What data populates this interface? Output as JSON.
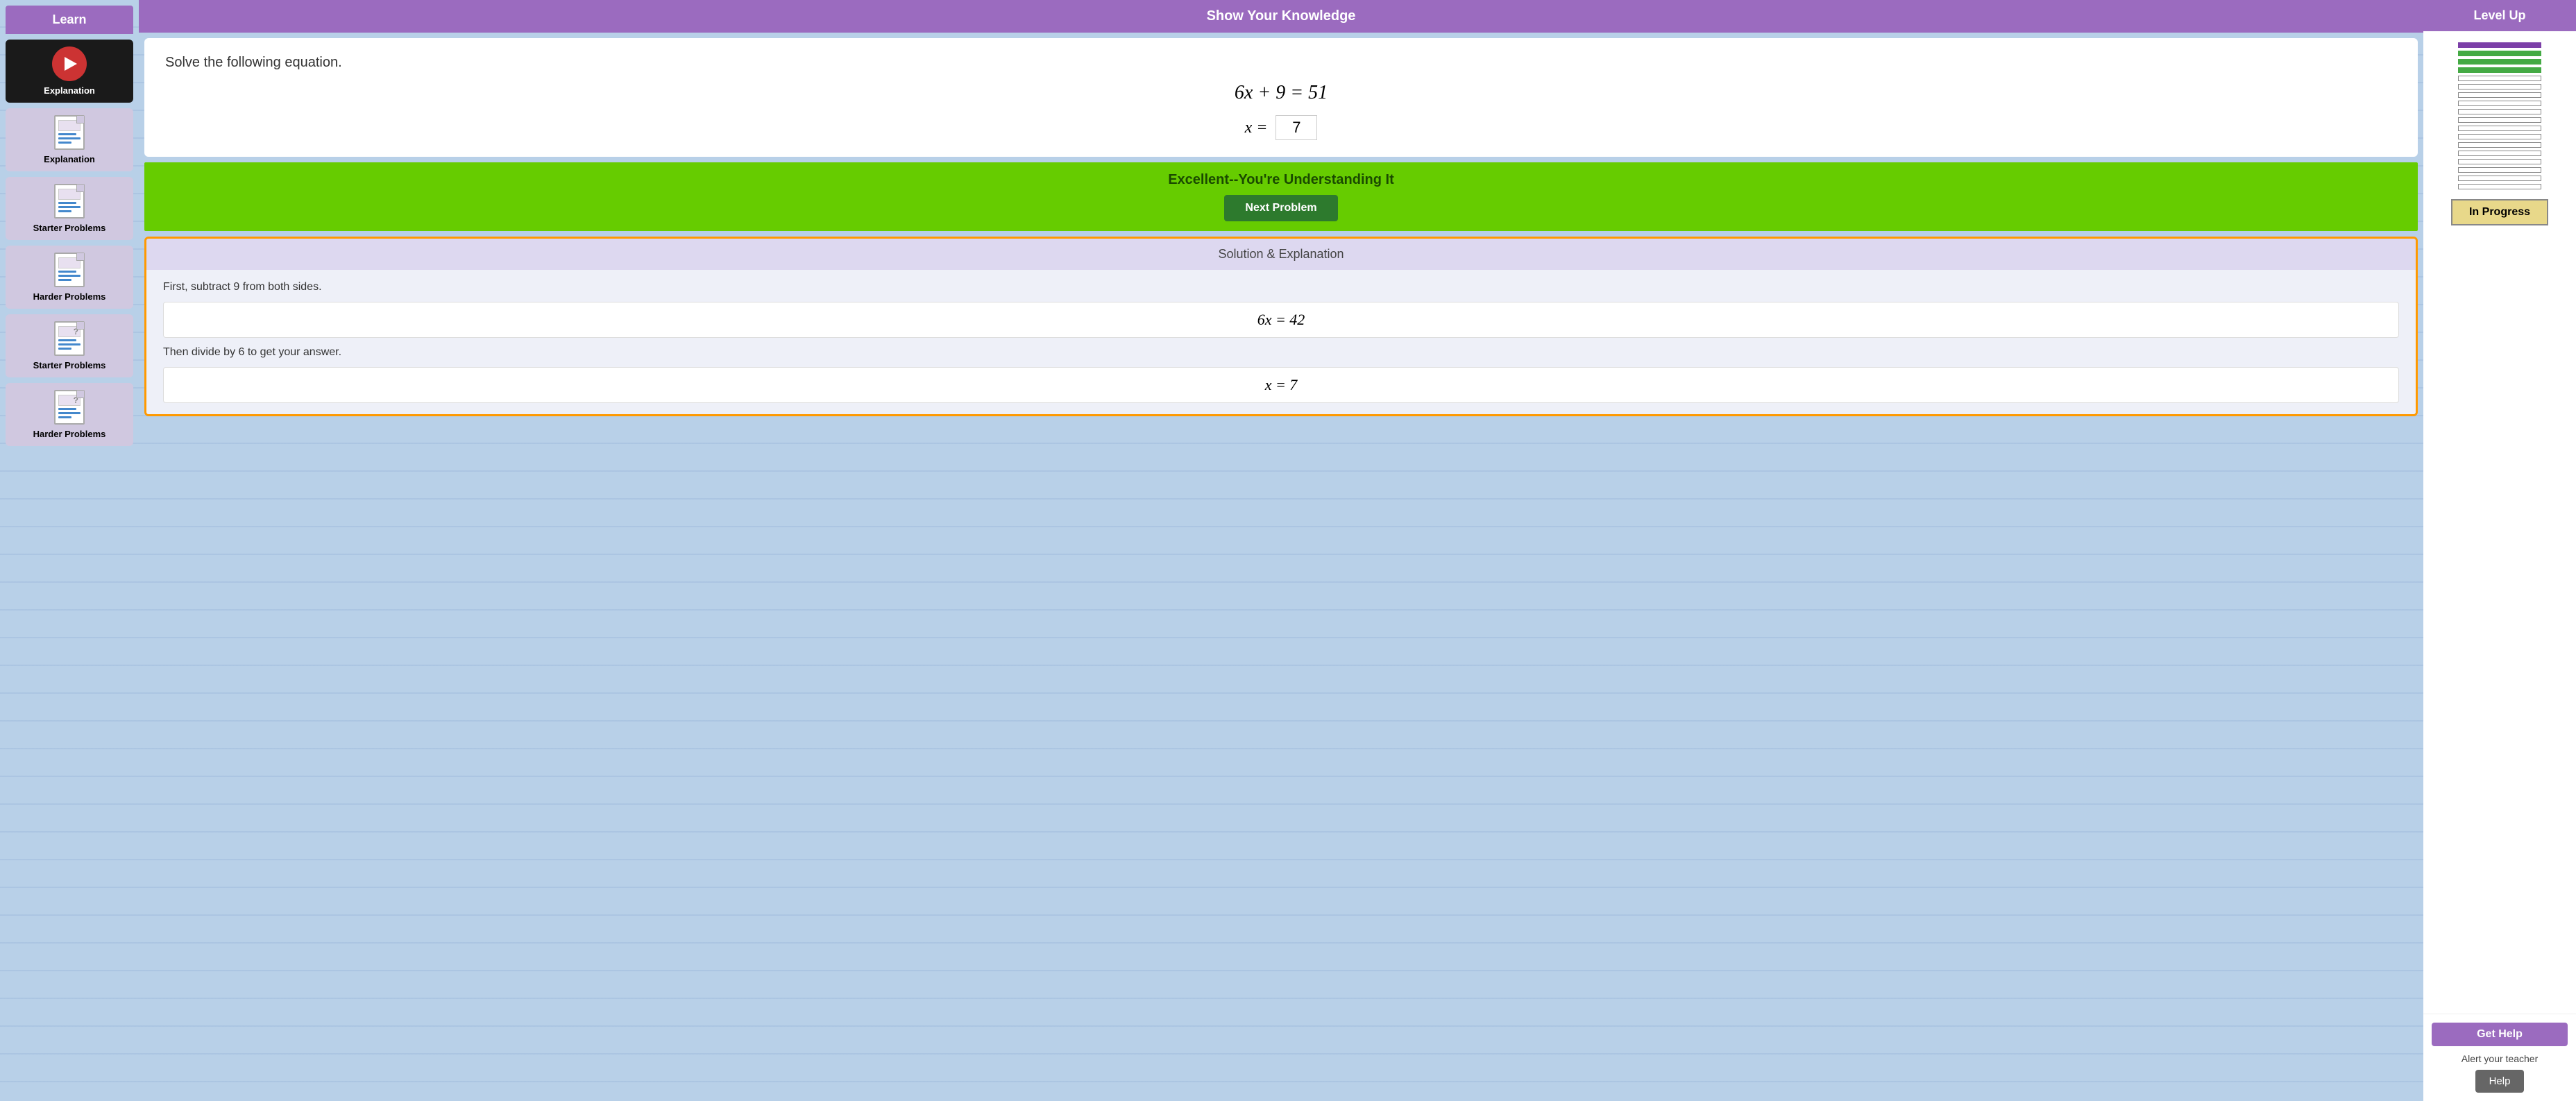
{
  "sidebar": {
    "header": "Learn",
    "items": [
      {
        "id": "explanation-video",
        "label": "Explanation",
        "type": "video",
        "active": true
      },
      {
        "id": "explanation-doc",
        "label": "Explanation",
        "type": "doc",
        "active": false
      },
      {
        "id": "starter-problems-1",
        "label": "Starter Problems",
        "type": "doc",
        "active": false
      },
      {
        "id": "harder-problems-1",
        "label": "Harder Problems",
        "type": "doc",
        "active": false
      },
      {
        "id": "starter-problems-2",
        "label": "Starter Problems",
        "type": "doc-question",
        "active": false
      },
      {
        "id": "harder-problems-2",
        "label": "Harder Problems",
        "type": "doc-question",
        "active": false
      }
    ]
  },
  "main": {
    "header": "Show Your Knowledge",
    "problem": {
      "instruction": "Solve the following equation.",
      "equation": "6x + 9 = 51",
      "answer_prefix": "x =",
      "answer_value": "7"
    },
    "feedback": {
      "message": "Excellent--You're Understanding It",
      "button_label": "Next Problem"
    },
    "solution": {
      "header": "Solution & Explanation",
      "steps": [
        {
          "text": "First, subtract 9 from both sides.",
          "equation": "6x = 42"
        },
        {
          "text": "Then divide by 6 to get your answer.",
          "equation": "x = 7"
        }
      ]
    }
  },
  "right_panel": {
    "level_up": {
      "header": "Level Up",
      "status_label": "In Progress",
      "tower_bars_total": 18,
      "tower_bars_purple": 1,
      "tower_bars_green": 3,
      "tower_bars_white": 14
    },
    "get_help": {
      "header": "Get Help",
      "alert_text": "Alert your teacher",
      "button_label": "Help"
    }
  }
}
